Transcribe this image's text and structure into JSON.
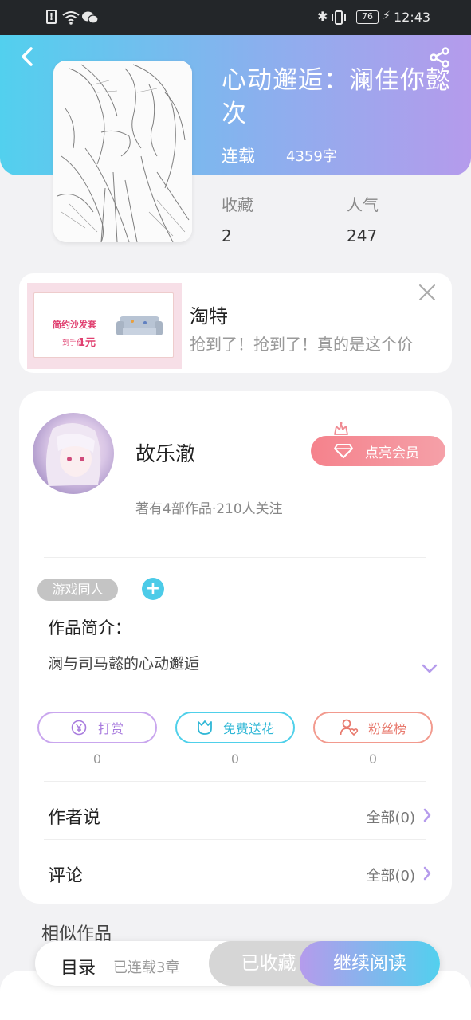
{
  "status_bar": {
    "time": "12:43",
    "battery": "76"
  },
  "book": {
    "title": "心动邂逅：澜佳你懿次",
    "status": "连载",
    "word_count": "4359字",
    "stats": [
      {
        "label": "收藏",
        "value": "2"
      },
      {
        "label": "人气",
        "value": "247"
      }
    ]
  },
  "ad": {
    "title": "淘特",
    "desc": "抢到了！抢到了！真的是这个价",
    "image_text": "简约沙发套",
    "image_price_label": "到手价",
    "image_price": "1元"
  },
  "author": {
    "name": "故乐澈",
    "info": "著有4部作品·210人关注",
    "vip_button": "点亮会员"
  },
  "tags": [
    "游戏同人"
  ],
  "intro": {
    "heading": "作品简介：",
    "text": "澜与司马懿的心动邂逅"
  },
  "actions": [
    {
      "label": "打赏",
      "count": "0"
    },
    {
      "label": "免费送花",
      "count": "0"
    },
    {
      "label": "粉丝榜",
      "count": "0"
    }
  ],
  "rows": [
    {
      "label": "作者说",
      "value": "全部(0)"
    },
    {
      "label": "评论",
      "value": "全部(0)"
    }
  ],
  "similar_heading": "相似作品",
  "bottom_bar": {
    "catalog": "目录",
    "chapters": "已连载3章",
    "collected": "已收藏",
    "continue": "继续阅读"
  },
  "colors": {
    "accent_purple": "#b59bec",
    "accent_cyan": "#52d0ee",
    "vip_red": "#f08a92",
    "fans_red": "#f29a8e"
  }
}
